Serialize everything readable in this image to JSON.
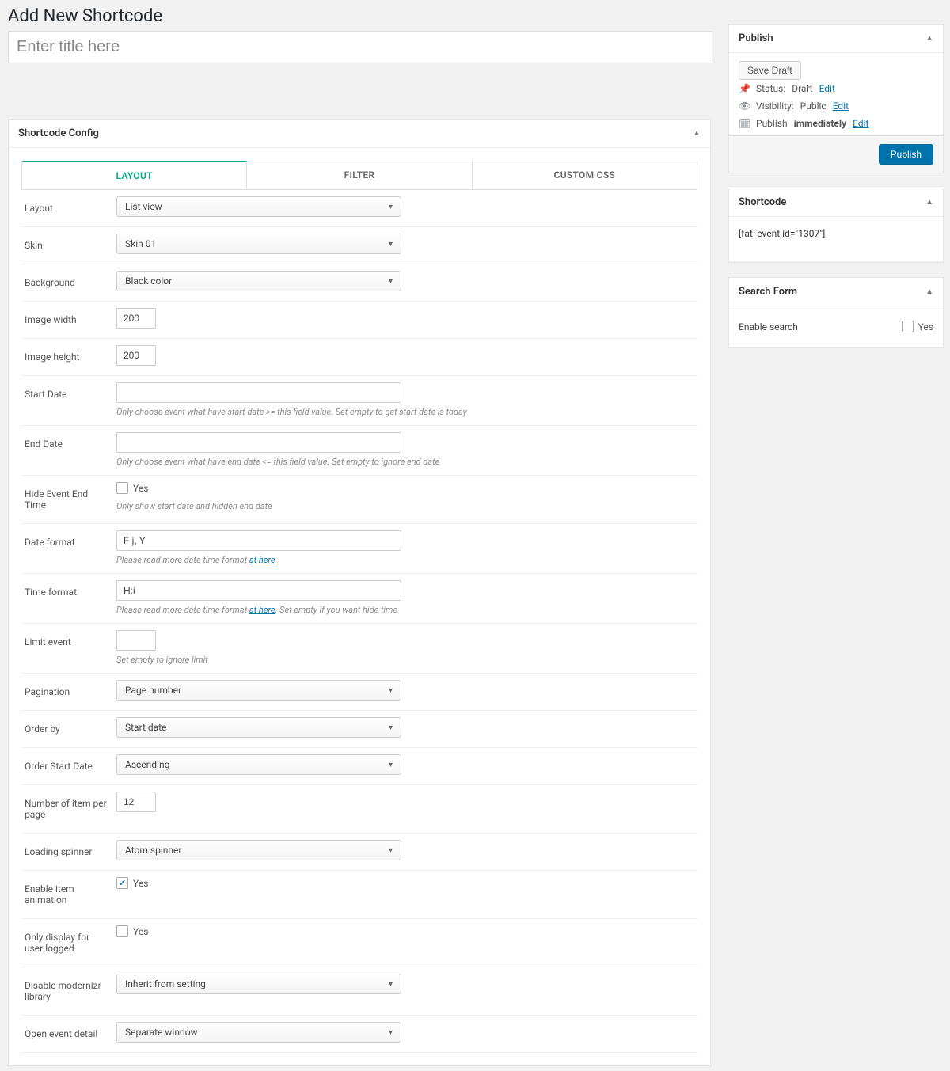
{
  "header": {
    "page_title": "Add New Shortcode",
    "title_placeholder": "Enter title here"
  },
  "config": {
    "box_title": "Shortcode Config",
    "tabs": {
      "layout": "LAYOUT",
      "filter": "FILTER",
      "custom_css": "CUSTOM CSS"
    },
    "rows": {
      "layout": {
        "label": "Layout",
        "value": "List view"
      },
      "skin": {
        "label": "Skin",
        "value": "Skin 01"
      },
      "background": {
        "label": "Background",
        "value": "Black color"
      },
      "image_width": {
        "label": "Image width",
        "value": "200"
      },
      "image_height": {
        "label": "Image height",
        "value": "200"
      },
      "start_date": {
        "label": "Start Date",
        "value": "",
        "desc": "Only choose event what have start date >= this field value. Set empty to get start date is today"
      },
      "end_date": {
        "label": "End Date",
        "value": "",
        "desc": "Only choose event what have end date <= this field value. Set empty to ignore end date"
      },
      "hide_end": {
        "label": "Hide Event End Time",
        "checked_label": "Yes",
        "desc": "Only show start date and hidden end date"
      },
      "date_format": {
        "label": "Date format",
        "value": "F j, Y",
        "desc_prefix": "Please read more date time format ",
        "desc_link": "at here"
      },
      "time_format": {
        "label": "Time format",
        "value": "H:i",
        "desc_prefix": "Please read more date time format ",
        "desc_link": "at here",
        "desc_suffix": ". Set empty if you want hide time"
      },
      "limit_event": {
        "label": "Limit event",
        "value": "",
        "desc": "Set empty to ignore limit"
      },
      "pagination": {
        "label": "Pagination",
        "value": "Page number"
      },
      "order_by": {
        "label": "Order by",
        "value": "Start date"
      },
      "order_start_date": {
        "label": "Order Start Date",
        "value": "Ascending"
      },
      "items_per_page": {
        "label": "Number of item per page",
        "value": "12"
      },
      "loading_spinner": {
        "label": "Loading spinner",
        "value": "Atom spinner"
      },
      "enable_anim": {
        "label": "Enable item animation",
        "checked_label": "Yes"
      },
      "only_logged": {
        "label": "Only display for user logged",
        "checked_label": "Yes"
      },
      "disable_modernizr": {
        "label": "Disable modernizr library",
        "value": "Inherit from setting"
      },
      "open_detail": {
        "label": "Open event detail",
        "value": "Separate window"
      }
    }
  },
  "publish": {
    "title": "Publish",
    "save_draft": "Save Draft",
    "status_label": "Status:",
    "status_value": "Draft",
    "visibility_label": "Visibility:",
    "visibility_value": "Public",
    "publish_label": "Publish",
    "publish_value": "immediately",
    "edit": "Edit",
    "publish_btn": "Publish"
  },
  "shortcode": {
    "title": "Shortcode",
    "text": "[fat_event id=\"1307\"]"
  },
  "searchform": {
    "title": "Search Form",
    "enable_label": "Enable search",
    "yes": "Yes"
  }
}
